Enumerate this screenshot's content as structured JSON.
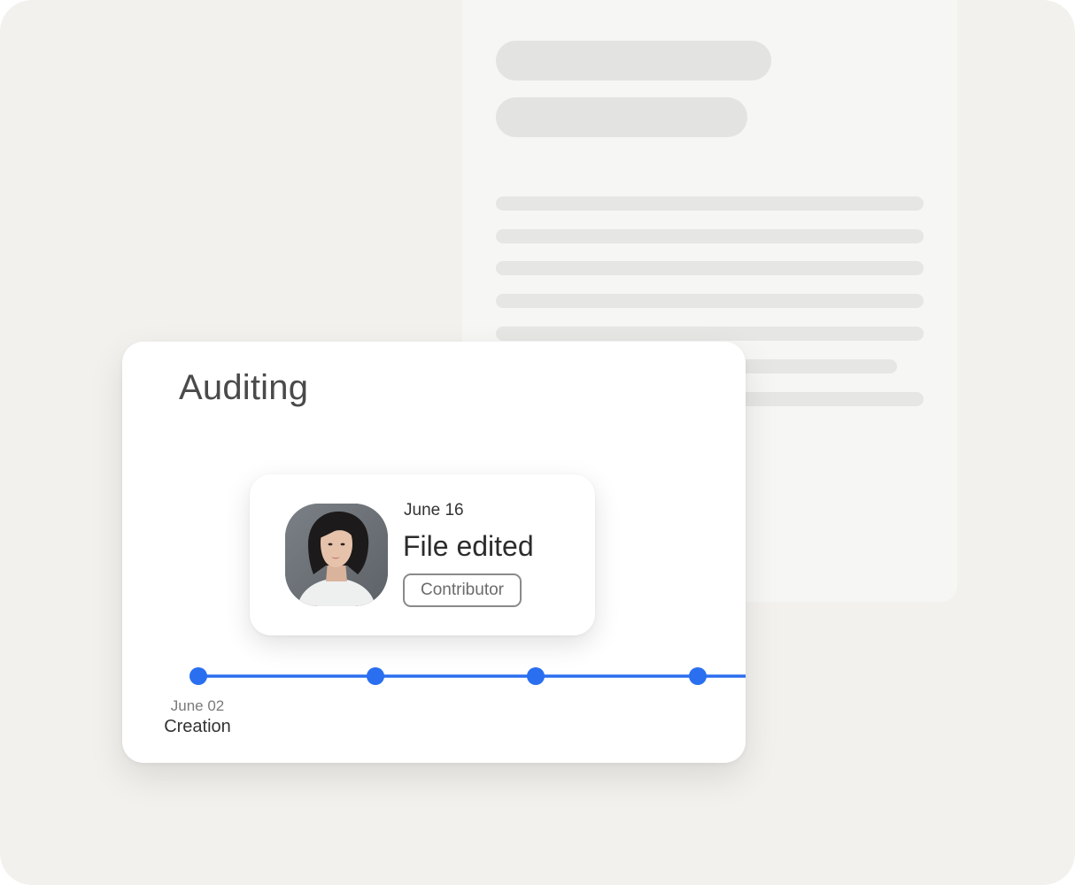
{
  "card": {
    "title": "Auditing"
  },
  "timeline": {
    "first_event": {
      "date": "June 02",
      "label": "Creation"
    },
    "point_count": 4,
    "accent_color": "#2a6ff0"
  },
  "popover": {
    "date": "June 16",
    "title": "File edited",
    "role_badge": "Contributor",
    "avatar": "user-avatar-photo"
  }
}
